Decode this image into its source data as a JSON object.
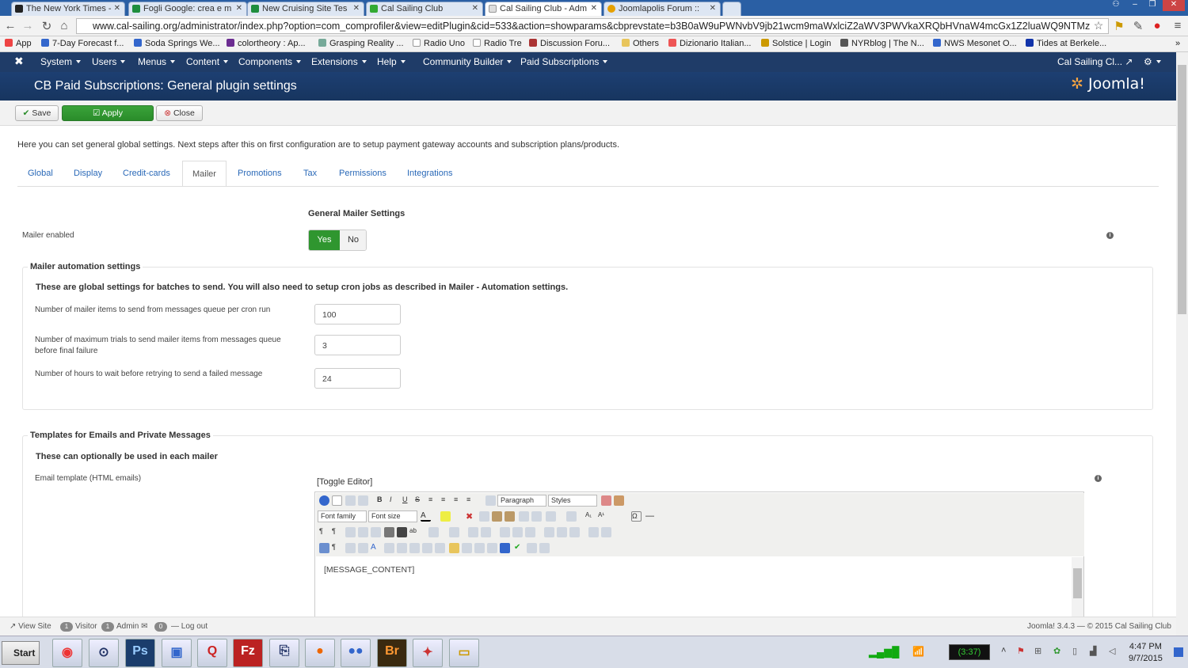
{
  "browser": {
    "tabs": [
      {
        "title": "The New York Times -",
        "color": "#222"
      },
      {
        "title": "Fogli Google: crea e m",
        "color": "#1e8e3e"
      },
      {
        "title": "New Cruising Site Tes",
        "color": "#1e8e3e"
      },
      {
        "title": "Cal Sailing Club",
        "color": "#3a3"
      },
      {
        "title": "Cal Sailing Club - Adm",
        "color": "#aaa"
      },
      {
        "title": "Joomlapolis Forum ::",
        "color": "#e6a000"
      }
    ],
    "url": "www.cal-sailing.org/administrator/index.php?option=com_comprofiler&view=editPlugin&cid=533&action=showparams&cbprevstate=b3B0aW9uPWNvbV9jb21wcm9maWxlciZ2aWV3PWVkaXRQbHVnaW4mcGx1Z2luaWQ9NTMz",
    "bookmarks": [
      "App",
      "7-Day Forecast f...",
      "Soda Springs We...",
      "colortheory : Ap...",
      "Grasping Reality ...",
      "Radio Uno",
      "Radio Tre",
      "Discussion Foru...",
      "Others",
      "Dizionario Italian...",
      "Solstice | Login",
      "NYRblog | The N...",
      "NWS Mesonet O...",
      "Tides at Berkele..."
    ],
    "more": "»"
  },
  "admin": {
    "menu": [
      "System",
      "Users",
      "Menus",
      "Content",
      "Components",
      "Extensions",
      "Help",
      "Community Builder",
      "Paid Subscriptions"
    ],
    "site_name": "Cal Sailing Cl...",
    "page_title": "CB Paid Subscriptions: General plugin settings",
    "logo": "Joomla!",
    "toolbar": {
      "save": "Save",
      "apply": "Apply",
      "close": "Close"
    },
    "intro": "Here you can set general global settings. Next steps after this on first configuration are to setup payment gateway accounts and subscription plans/products.",
    "tabs": [
      "Global",
      "Display",
      "Credit-cards",
      "Mailer",
      "Promotions",
      "Tax",
      "Permissions",
      "Integrations"
    ],
    "active_tab": "Mailer"
  },
  "mailer": {
    "section_title": "General Mailer Settings",
    "enabled_label": "Mailer enabled",
    "yes": "Yes",
    "no": "No",
    "enabled": true,
    "automation": {
      "legend": "Mailer automation settings",
      "desc": "These are global settings for batches to send. You will also need to setup cron jobs as described in Mailer - Automation settings.",
      "fields": [
        {
          "label": "Number of mailer items to send from messages queue per cron run",
          "value": "100"
        },
        {
          "label": "Number of maximum trials to send mailer items from messages queue before final failure",
          "value": "3"
        },
        {
          "label": "Number of hours to wait before retrying to send a failed message",
          "value": "24"
        }
      ]
    },
    "templates": {
      "legend": "Templates for Emails and Private Messages",
      "desc": "These can optionally be used in each mailer",
      "email_label": "Email template (HTML emails)",
      "toggle": "[Toggle Editor]",
      "paragraph": "Paragraph",
      "styles": "Styles",
      "font_family": "Font family",
      "font_size": "Font size",
      "content": "[MESSAGE_CONTENT]"
    }
  },
  "status": {
    "view_site": "View Site",
    "visitors_count": "1",
    "visitors": "Visitor",
    "admins_count": "1",
    "admins": "Admin",
    "messages_count": "0",
    "logout": "Log out",
    "footer": "Joomla! 3.4.3 — © 2015 Cal Sailing Club"
  },
  "taskbar": {
    "start": "Start",
    "battery": "(3:37)",
    "time": "4:47 PM",
    "date": "9/7/2015"
  },
  "colors": {
    "accent": "#2a69b8",
    "green": "#2f962f",
    "header": "#1a3867"
  }
}
